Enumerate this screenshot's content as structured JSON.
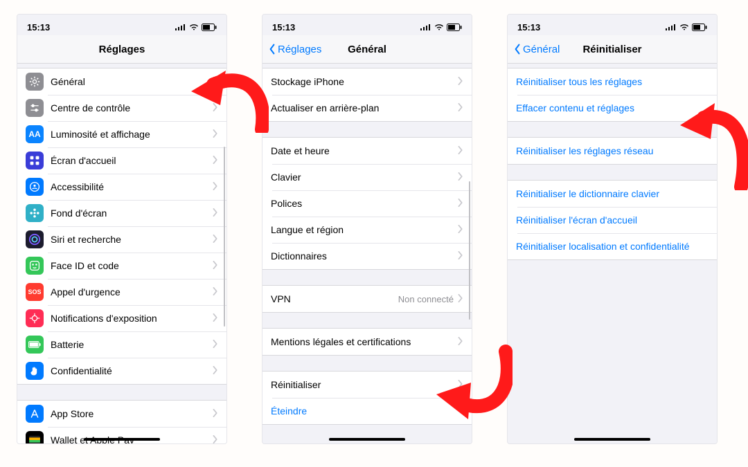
{
  "status": {
    "time": "15:13"
  },
  "screen1": {
    "title": "Réglages",
    "items": [
      {
        "name": "general",
        "label": "Général",
        "iconClass": "ic-general",
        "glyph": "gear"
      },
      {
        "name": "control-center",
        "label": "Centre de contrôle",
        "iconClass": "ic-control",
        "glyph": "sliders"
      },
      {
        "name": "display",
        "label": "Luminosité et affichage",
        "iconClass": "ic-display",
        "glyph": "AA"
      },
      {
        "name": "home-screen",
        "label": "Écran d'accueil",
        "iconClass": "ic-home",
        "glyph": "grid"
      },
      {
        "name": "accessibility",
        "label": "Accessibilité",
        "iconClass": "ic-access",
        "glyph": "person"
      },
      {
        "name": "wallpaper",
        "label": "Fond d'écran",
        "iconClass": "ic-wall",
        "glyph": "flower"
      },
      {
        "name": "siri",
        "label": "Siri et recherche",
        "iconClass": "ic-siri",
        "glyph": "siri"
      },
      {
        "name": "faceid",
        "label": "Face ID et code",
        "iconClass": "ic-face",
        "glyph": "face"
      },
      {
        "name": "sos",
        "label": "Appel d'urgence",
        "iconClass": "ic-sos",
        "glyph": "SOS"
      },
      {
        "name": "exposure",
        "label": "Notifications d'exposition",
        "iconClass": "ic-expo",
        "glyph": "virus"
      },
      {
        "name": "battery",
        "label": "Batterie",
        "iconClass": "ic-batt",
        "glyph": "batt"
      },
      {
        "name": "privacy",
        "label": "Confidentialité",
        "iconClass": "ic-priv",
        "glyph": "hand"
      }
    ],
    "storeItems": [
      {
        "name": "appstore",
        "label": "App Store",
        "iconClass": "ic-appstore",
        "glyph": "A"
      },
      {
        "name": "wallet",
        "label": "Wallet et Apple Pay",
        "iconClass": "ic-wallet",
        "glyph": "wallet"
      }
    ]
  },
  "screen2": {
    "backLabel": "Réglages",
    "title": "Général",
    "g1": [
      {
        "name": "storage",
        "label": "Stockage iPhone"
      },
      {
        "name": "background-refresh",
        "label": "Actualiser en arrière-plan"
      }
    ],
    "g2": [
      {
        "name": "date-time",
        "label": "Date et heure"
      },
      {
        "name": "keyboard",
        "label": "Clavier"
      },
      {
        "name": "fonts",
        "label": "Polices"
      },
      {
        "name": "language",
        "label": "Langue et région"
      },
      {
        "name": "dictionaries",
        "label": "Dictionnaires"
      }
    ],
    "g3": [
      {
        "name": "vpn",
        "label": "VPN",
        "detail": "Non connecté"
      }
    ],
    "g4": [
      {
        "name": "legal",
        "label": "Mentions légales et certifications"
      }
    ],
    "g5": [
      {
        "name": "reset",
        "label": "Réinitialiser",
        "chevron": true
      },
      {
        "name": "shutdown",
        "label": "Éteindre",
        "link": true
      }
    ]
  },
  "screen3": {
    "backLabel": "Général",
    "title": "Réinitialiser",
    "g1": [
      {
        "name": "reset-all",
        "label": "Réinitialiser tous les réglages"
      },
      {
        "name": "erase-all",
        "label": "Effacer contenu et réglages"
      }
    ],
    "g2": [
      {
        "name": "reset-network",
        "label": "Réinitialiser les réglages réseau"
      }
    ],
    "g3": [
      {
        "name": "reset-dict",
        "label": "Réinitialiser le dictionnaire clavier"
      },
      {
        "name": "reset-home",
        "label": "Réinitialiser l'écran d'accueil"
      },
      {
        "name": "reset-location",
        "label": "Réinitialiser localisation et confidentialité"
      }
    ]
  }
}
